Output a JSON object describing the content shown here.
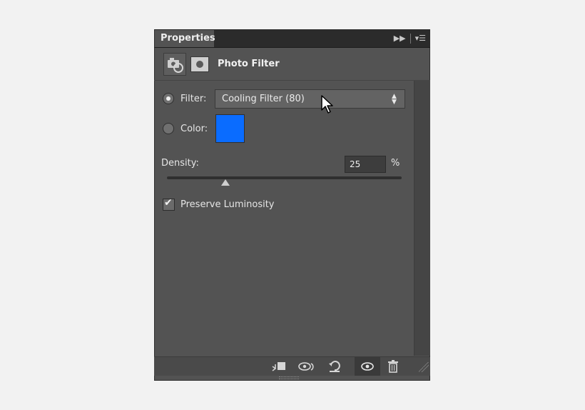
{
  "tab": {
    "label": "Properties"
  },
  "header": {
    "title": "Photo Filter"
  },
  "filter": {
    "label": "Filter:",
    "value": "Cooling Filter (80)",
    "selected": true
  },
  "color": {
    "label": "Color:",
    "swatch": "#0a6cff",
    "selected": false
  },
  "density": {
    "label": "Density:",
    "value": "25",
    "unit": "%",
    "slider_fraction": 0.25
  },
  "preserve": {
    "label": "Preserve Luminosity",
    "checked": true
  },
  "icons": {
    "tab_forward": "double-chevron-right-icon",
    "panel_menu": "panel-menu-icon",
    "adjustment": "adjustment-camera-icon",
    "mask": "mask-icon",
    "clip": "clip-to-layer-icon",
    "view_previous": "view-previous-state-icon",
    "reset": "reset-icon",
    "visibility": "eye-icon",
    "delete": "trash-icon"
  }
}
